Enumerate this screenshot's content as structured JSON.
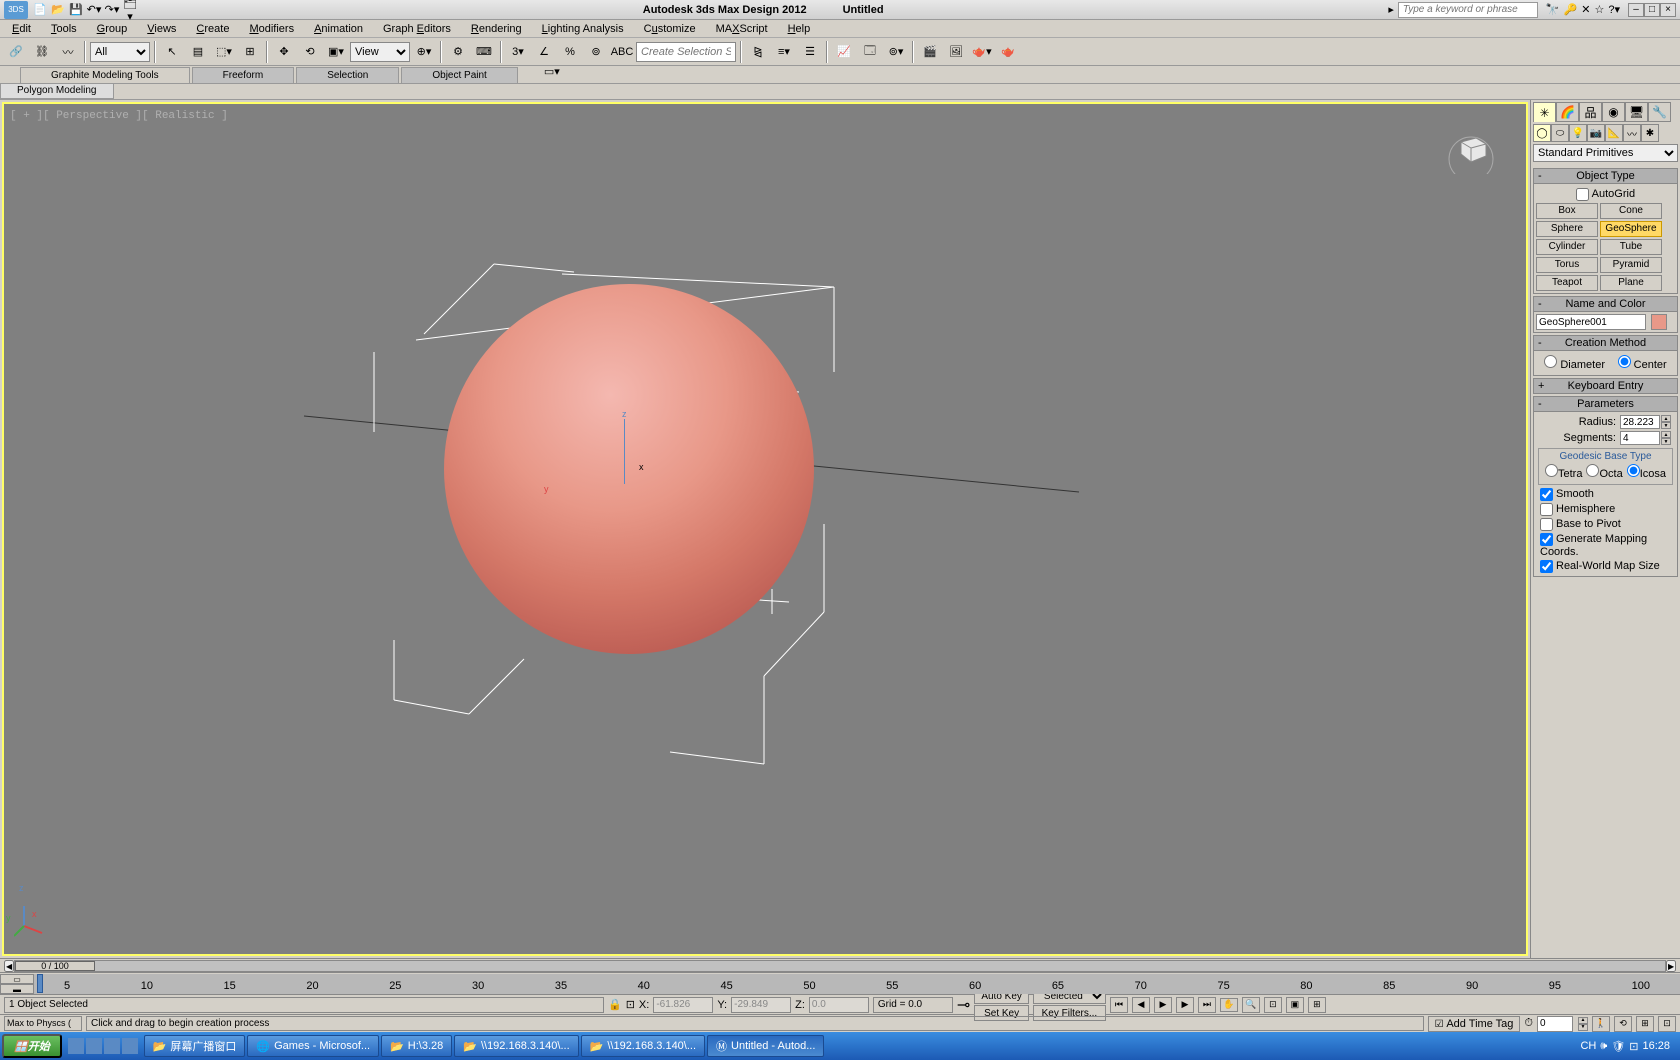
{
  "title": {
    "app": "Autodesk 3ds Max Design 2012",
    "doc": "Untitled",
    "search_ph": "Type a keyword or phrase"
  },
  "menus": [
    "Edit",
    "Tools",
    "Group",
    "Views",
    "Create",
    "Modifiers",
    "Animation",
    "Graph Editors",
    "Rendering",
    "Lighting Analysis",
    "Customize",
    "MAXScript",
    "Help"
  ],
  "toolbar": {
    "filter_all": "All",
    "view": "View",
    "sel_set_ph": "Create Selection Set"
  },
  "ribbon": {
    "tabs": [
      "Graphite Modeling Tools",
      "Freeform",
      "Selection",
      "Object Paint"
    ],
    "subtab": "Polygon Modeling"
  },
  "viewport": {
    "label": "[ + ][ Perspective ][ Realistic ]"
  },
  "panel": {
    "category": "Standard Primitives",
    "rollouts": {
      "obj_type": "Object Type",
      "autogrid": "AutoGrid",
      "name_color": "Name and Color",
      "creation": "Creation Method",
      "keyboard": "Keyboard Entry",
      "params": "Parameters",
      "geodesic": "Geodesic Base Type"
    },
    "primitives": [
      "Box",
      "Cone",
      "Sphere",
      "GeoSphere",
      "Cylinder",
      "Tube",
      "Torus",
      "Pyramid",
      "Teapot",
      "Plane"
    ],
    "active_primitive": "GeoSphere",
    "obj_name": "GeoSphere001",
    "creation_opts": {
      "diameter": "Diameter",
      "center": "Center"
    },
    "params": {
      "radius_l": "Radius:",
      "radius_v": "28.223",
      "segments_l": "Segments:",
      "segments_v": "4"
    },
    "geo_opts": {
      "tetra": "Tetra",
      "octa": "Octa",
      "icosa": "Icosa"
    },
    "checks": {
      "smooth": "Smooth",
      "hemisphere": "Hemisphere",
      "base_pivot": "Base to Pivot",
      "mapping": "Generate Mapping Coords.",
      "realworld": "Real-World Map Size"
    }
  },
  "timeline": {
    "frame": "0 / 100",
    "marks": [
      5,
      10,
      15,
      20,
      25,
      30,
      35,
      40,
      45,
      50,
      55,
      60,
      65,
      70,
      75,
      80,
      85,
      90,
      95,
      100
    ]
  },
  "status": {
    "selection": "1 Object Selected",
    "x_l": "X:",
    "x_v": "-61.826",
    "y_l": "Y:",
    "y_v": "-29.849",
    "z_l": "Z:",
    "z_v": "0.0",
    "grid": "Grid = 0.0",
    "autokey": "Auto Key",
    "setkey": "Set Key",
    "selected": "Selected",
    "keyfilters": "Key Filters...",
    "frame_spin": "0",
    "prompt": "Click and drag to begin creation process",
    "maxphysx": "Max to Physcs (",
    "add_tag": "Add Time Tag"
  },
  "taskbar": {
    "start": "开始",
    "tasks": [
      {
        "icon": "📂",
        "label": "屏幕广播窗口"
      },
      {
        "icon": "🌐",
        "label": "Games - Microsof..."
      },
      {
        "icon": "📂",
        "label": "H:\\3.28"
      },
      {
        "icon": "📂",
        "label": "\\\\192.168.3.140\\..."
      },
      {
        "icon": "📂",
        "label": "\\\\192.168.3.140\\..."
      },
      {
        "icon": "Ⓜ",
        "label": "Untitled - Autod..."
      }
    ],
    "tray": {
      "ime": "CH",
      "clock": "16:28"
    }
  }
}
